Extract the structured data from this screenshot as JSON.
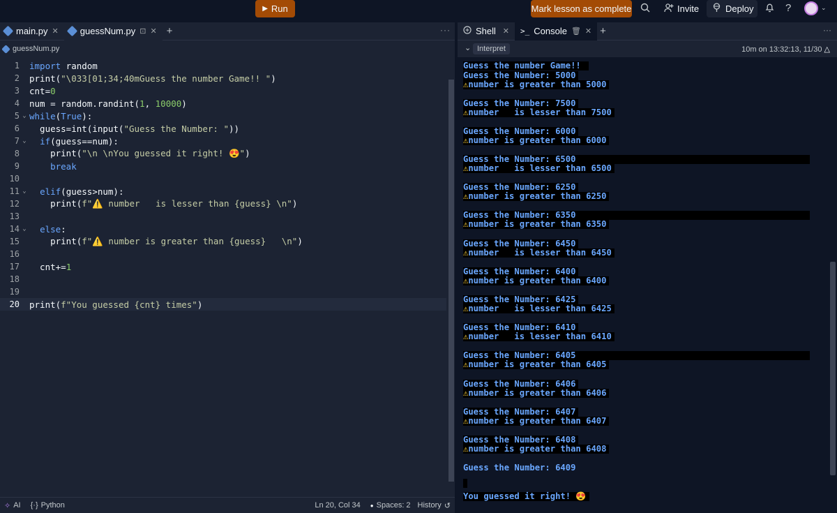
{
  "topbar": {
    "run_label": "Run",
    "mark_label": "Mark lesson as complete",
    "invite_label": "Invite",
    "deploy_label": "Deploy",
    "help_label": "?"
  },
  "editor_tabs": [
    {
      "label": "main.py"
    },
    {
      "label": "guessNum.py"
    }
  ],
  "breadcrumb": "guessNum.py",
  "code_lines": [
    "1",
    "2",
    "3",
    "4",
    "5",
    "6",
    "7",
    "8",
    "9",
    "10",
    "11",
    "12",
    "13",
    "14",
    "15",
    "16",
    "17",
    "18",
    "19",
    "20"
  ],
  "code": {
    "l1a": "import",
    "l1b": " random",
    "l2a": "print(",
    "l2b": "\"\\033[01;34;40mGuess the number Game!! \"",
    "l2c": ")",
    "l3a": "cnt=",
    "l3b": "0",
    "l4a": "num = random.randint(",
    "l4b": "1",
    "l4c": ", ",
    "l4d": "10000",
    "l4e": ")",
    "l5a": "while",
    "l5b": "(",
    "l5c": "True",
    "l5d": "):",
    "l6a": "  guess=int(input(",
    "l6b": "\"Guess the Number: \"",
    "l6c": "))",
    "l7a": "  ",
    "l7b": "if",
    "l7c": "(guess==num):",
    "l8a": "    print(",
    "l8b": "\"\\n \\nYou guessed it right! 😍\"",
    "l8c": ")",
    "l9a": "    ",
    "l9b": "break",
    "l11a": "  ",
    "l11b": "elif",
    "l11c": "(guess>num):",
    "l12a": "    print(",
    "l12b": "f\"⚠️ number   is lesser than {guess} \\n\"",
    "l12c": ")",
    "l14a": "  ",
    "l14b": "else",
    "l14c": ":",
    "l15a": "    print(",
    "l15b": "f\"⚠️ number is greater than {guess}   \\n\"",
    "l15c": ")",
    "l17a": "  cnt+=",
    "l17b": "1",
    "l20a": "print(",
    "l20b": "f\"You guessed {cnt} times\"",
    "l20c": ")"
  },
  "statusbar": {
    "ai": "AI",
    "lang": "Python",
    "pos": "Ln 20, Col 34",
    "spaces": "Spaces: 2",
    "history": "History"
  },
  "right_tabs": [
    {
      "label": "Shell"
    },
    {
      "label": "Console"
    }
  ],
  "interpret_label": "Interpret",
  "time_info": "10m on 13:32:13, 11/30",
  "console_lines": [
    "Guess the number Game!! ",
    "Guess the Number: 5000",
    "number is greater than 5000",
    "Guess the Number: 7500",
    "number   is lesser than 7500",
    "Guess the Number: 6000",
    "number is greater than 6000",
    "Guess the Number: 6500",
    "number   is lesser than 6500",
    "Guess the Number: 6250",
    "number is greater than 6250",
    "Guess the Number: 6350",
    "number is greater than 6350",
    "Guess the Number: 6450",
    "number   is lesser than 6450",
    "Guess the Number: 6400",
    "number is greater than 6400",
    "Guess the Number: 6425",
    "number   is lesser than 6425",
    "Guess the Number: 6410",
    "number   is lesser than 6410",
    "Guess the Number: 6405",
    "number is greater than 6405",
    "Guess the Number: 6406",
    "number is greater than 6406",
    "Guess the Number: 6407",
    "number is greater than 6407",
    "Guess the Number: 6408",
    "number is greater than 6408",
    "Guess the Number: 6409",
    "You guessed it right! 😍"
  ]
}
